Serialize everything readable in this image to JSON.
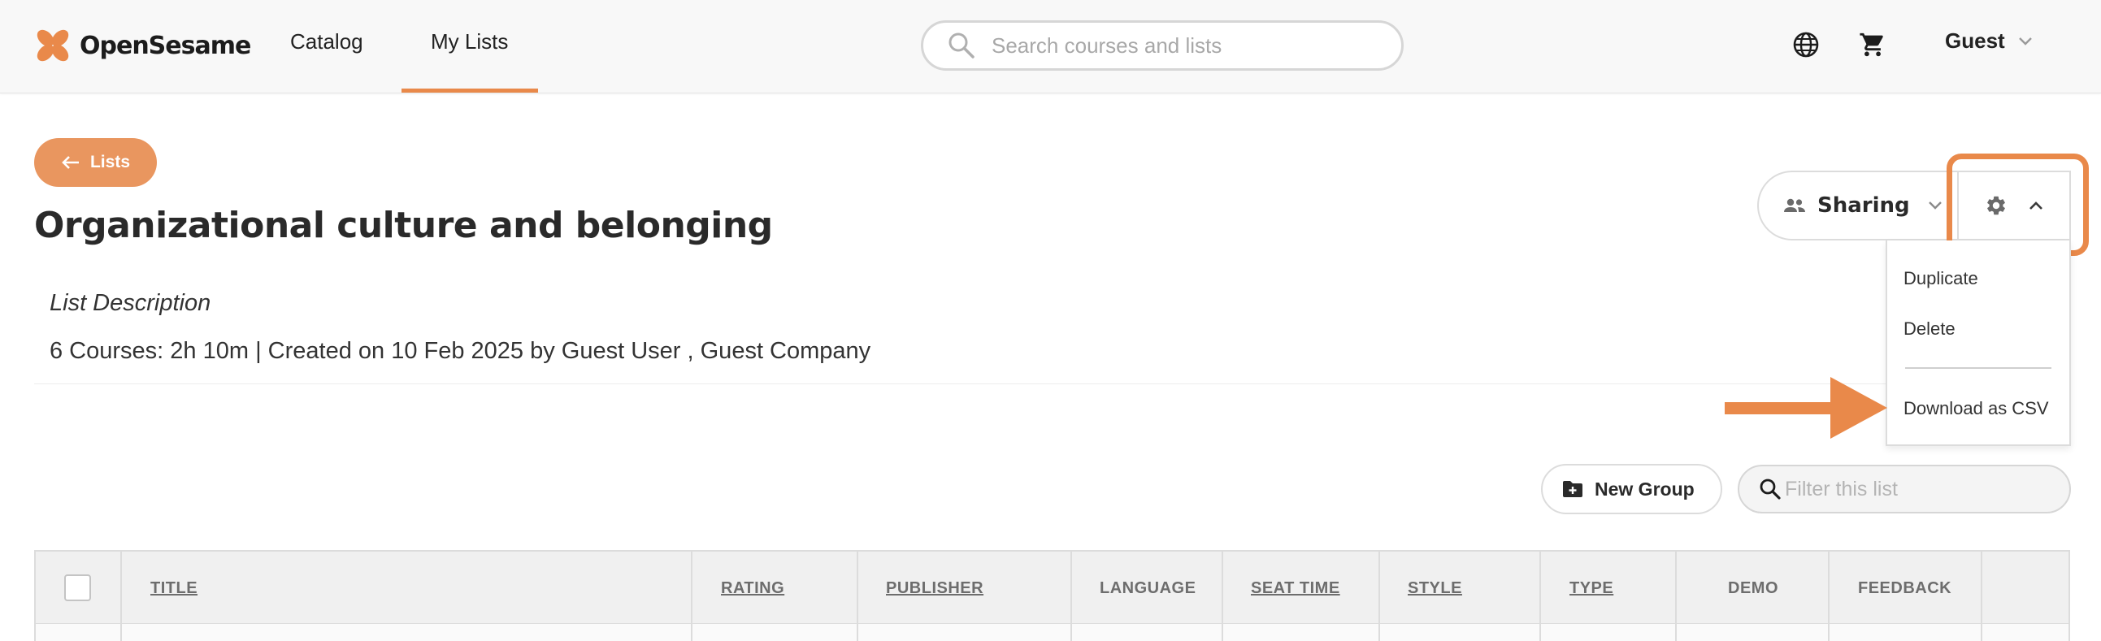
{
  "header": {
    "brand": "OpenSesame",
    "nav": {
      "catalog": "Catalog",
      "my_lists": "My Lists"
    },
    "search_placeholder": "Search courses and lists",
    "user_label": "Guest",
    "icons": [
      "globe-icon",
      "cart-icon",
      "chevron-down-icon"
    ]
  },
  "back_button": {
    "label": "Lists"
  },
  "list": {
    "title": "Organizational culture and belonging",
    "description_label": "List Description",
    "meta": "6 Courses: 2h 10m | Created on 10 Feb 2025 by Guest User , Guest Company"
  },
  "sharing": {
    "label": "Sharing"
  },
  "settings_menu": {
    "items": [
      "Duplicate",
      "Delete",
      "Download as CSV"
    ]
  },
  "toolbar": {
    "new_group": "New Group",
    "filter_placeholder": "Filter this list"
  },
  "table": {
    "columns": [
      {
        "label": "TITLE",
        "sortable": true
      },
      {
        "label": "RATING",
        "sortable": true
      },
      {
        "label": "PUBLISHER",
        "sortable": true
      },
      {
        "label": "LANGUAGE",
        "sortable": false
      },
      {
        "label": "SEAT TIME",
        "sortable": true
      },
      {
        "label": "STYLE",
        "sortable": true
      },
      {
        "label": "TYPE",
        "sortable": true
      },
      {
        "label": "DEMO",
        "sortable": false
      },
      {
        "label": "FEEDBACK",
        "sortable": false
      }
    ]
  },
  "colors": {
    "accent": "#e9894a",
    "button_fill": "#e9965f",
    "table_header_bg": "#f0f0f0",
    "text_dark": "#2a2a2a"
  }
}
